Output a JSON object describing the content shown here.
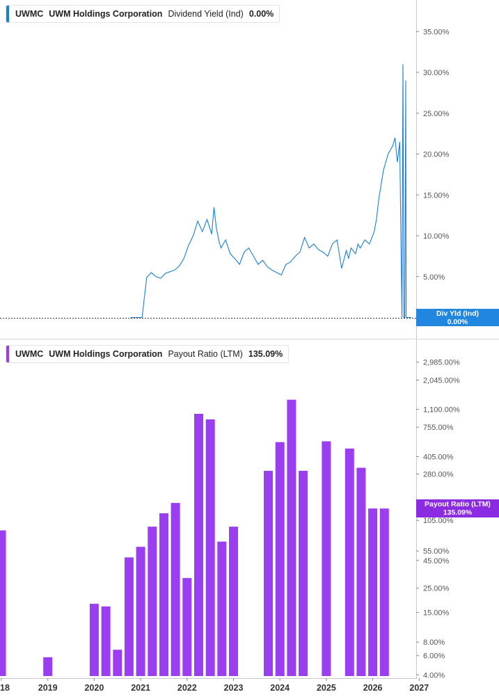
{
  "colors": {
    "yield_line": "#1a7fd6",
    "payout_bar": "#9b3ef0",
    "yield_tag": "#2186e0",
    "payout_tag": "#8a2be2"
  },
  "top_legend": {
    "ticker": "UWMC",
    "company": "UWM Holdings Corporation",
    "metric": "Dividend Yield (Ind)",
    "value": "0.00%"
  },
  "bottom_legend": {
    "ticker": "UWMC",
    "company": "UWM Holdings Corporation",
    "metric": "Payout Ratio (LTM)",
    "value": "135.09%"
  },
  "yield_tag": {
    "label": "Div Yld (Ind)",
    "value": "0.00%"
  },
  "payout_tag": {
    "label": "Payout Ratio (LTM)",
    "value": "135.09%"
  },
  "chart_data": [
    {
      "type": "line",
      "title": "Dividend Yield (Ind)",
      "series": [
        {
          "name": "UWM Holdings Corporation",
          "x": [
            2020.75,
            2020.8,
            2020.81,
            2020.85,
            2020.9,
            2020.95,
            2021.0,
            2021.1,
            2021.2,
            2021.3,
            2021.4,
            2021.5,
            2021.6,
            2021.7,
            2021.8,
            2021.9,
            2022.0,
            2022.1,
            2022.2,
            2022.3,
            2022.4,
            2022.5,
            2022.55,
            2022.6,
            2022.65,
            2022.7,
            2022.8,
            2022.9,
            2023.0,
            2023.1,
            2023.2,
            2023.3,
            2023.4,
            2023.5,
            2023.6,
            2023.7,
            2023.8,
            2023.9,
            2024.0,
            2024.1,
            2024.2,
            2024.3,
            2024.4,
            2024.5,
            2024.6,
            2024.7,
            2024.8,
            2024.9,
            2025.0,
            2025.1,
            2025.2,
            2025.3,
            2025.4,
            2025.45,
            2025.5,
            2025.6,
            2025.65,
            2025.7,
            2025.8,
            2025.9,
            2026.0,
            2026.05,
            2026.1,
            2026.2,
            2026.3,
            2026.4,
            2026.45,
            2026.5,
            2026.55,
            2026.6,
            2026.62,
            2026.64,
            2026.66,
            2026.68,
            2026.69,
            2026.7,
            2026.72,
            2026.74,
            2026.75,
            2026.76,
            2026.77,
            2026.78,
            2026.8
          ],
          "values": [
            0,
            0,
            0,
            0,
            0,
            0,
            0,
            4.9,
            5.5,
            5.0,
            4.8,
            5.4,
            5.6,
            5.8,
            6.3,
            7.2,
            8.8,
            10.0,
            11.8,
            10.5,
            12.0,
            10.2,
            13.5,
            11.0,
            9.5,
            8.5,
            9.5,
            7.8,
            7.2,
            6.5,
            8.0,
            8.5,
            7.5,
            6.5,
            7.0,
            6.2,
            5.8,
            5.5,
            5.2,
            6.5,
            6.8,
            7.5,
            8.0,
            9.8,
            8.5,
            9.0,
            8.3,
            8.0,
            7.5,
            9.0,
            9.5,
            6.0,
            8.2,
            7.2,
            8.5,
            7.8,
            9.0,
            8.5,
            9.5,
            9.0,
            10.5,
            12.0,
            14.5,
            18.0,
            20.0,
            21.0,
            22.0,
            19.0,
            21.5,
            0,
            31.0,
            0,
            0,
            29.0,
            0,
            0,
            0,
            0,
            0,
            0,
            0,
            0,
            0
          ]
        }
      ],
      "y_ticks": [
        "0.00%",
        "5.00%",
        "10.00%",
        "15.00%",
        "20.00%",
        "25.00%",
        "30.00%",
        "35.00%"
      ],
      "ylim": [
        0,
        37
      ],
      "xlim": [
        2017.97,
        2026.97
      ],
      "grid": false
    },
    {
      "type": "bar",
      "title": "Payout Ratio (LTM)",
      "y_scale": "log",
      "series": [
        {
          "name": "UWM Holdings Corporation",
          "x": [
            2017.97,
            2018.97,
            2019.97,
            2020.22,
            2020.47,
            2020.72,
            2020.97,
            2021.22,
            2021.47,
            2021.72,
            2021.97,
            2022.22,
            2022.47,
            2022.72,
            2022.97,
            2023.72,
            2023.97,
            2024.22,
            2024.47,
            2024.97,
            2025.47,
            2025.72,
            2025.97,
            2026.22
          ],
          "values": [
            85,
            5.8,
            18,
            17,
            6.8,
            48,
            60,
            92,
            122,
            152,
            31,
            1000,
            890,
            67,
            92,
            300,
            550,
            1350,
            300,
            560,
            480,
            320,
            135,
            135
          ]
        }
      ],
      "y_ticks": [
        "4.00%",
        "6.00%",
        "8.00%",
        "15.00%",
        "25.00%",
        "45.00%",
        "55.00%",
        "105.00%",
        "280.00%",
        "405.00%",
        "755.00%",
        "1,100.00%",
        "2,045.00%",
        "2,985.00%"
      ],
      "x_ticks": [
        "18",
        "2019",
        "2020",
        "2021",
        "2022",
        "2023",
        "2024",
        "2025",
        "2026",
        "2027"
      ],
      "ylim": [
        3.9,
        3200
      ],
      "xlim": [
        2017.97,
        2026.97
      ],
      "grid": false
    }
  ]
}
